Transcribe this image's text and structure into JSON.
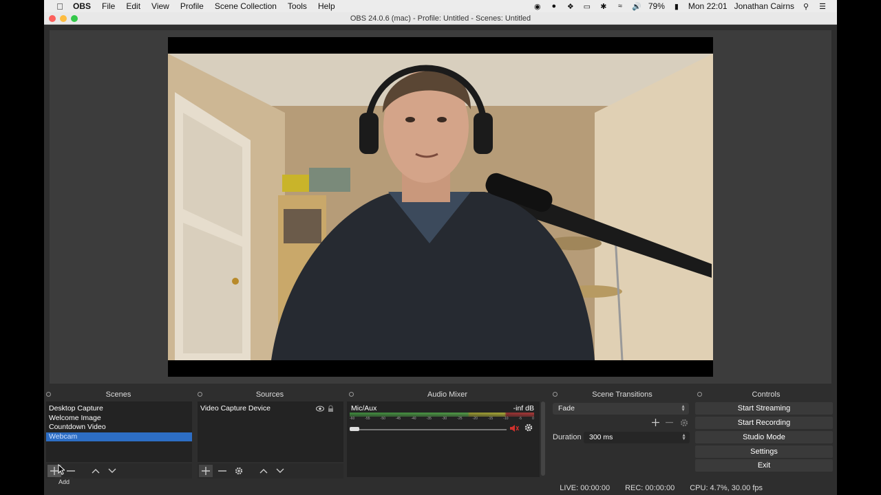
{
  "menubar": {
    "apple_icon": "apple-icon",
    "items": [
      "OBS",
      "File",
      "Edit",
      "View",
      "Profile",
      "Scene Collection",
      "Tools",
      "Help"
    ],
    "battery": "79%",
    "clock": "Mon 22:01",
    "user": "Jonathan Cairns"
  },
  "window": {
    "title": "OBS 24.0.6 (mac) - Profile: Untitled - Scenes: Untitled"
  },
  "scenes": {
    "title": "Scenes",
    "items": [
      "Desktop Capture",
      "Welcome Image",
      "Countdown Video",
      "Webcam"
    ],
    "selected_index": 3
  },
  "sources": {
    "title": "Sources",
    "items": [
      "Video Capture Device"
    ]
  },
  "mixer": {
    "title": "Audio Mixer",
    "channel": "Mic/Aux",
    "level": "-inf dB",
    "ticks": [
      "-60",
      "-55",
      "-50",
      "-45",
      "-40",
      "-35",
      "-30",
      "-25",
      "-20",
      "-15",
      "-10",
      "-5",
      "0"
    ],
    "volume_fraction": 0.0,
    "muted": true
  },
  "transitions": {
    "title": "Scene Transitions",
    "selected": "Fade",
    "duration_label": "Duration",
    "duration_value": "300 ms"
  },
  "controls": {
    "title": "Controls",
    "buttons": [
      "Start Streaming",
      "Start Recording",
      "Studio Mode",
      "Settings",
      "Exit"
    ]
  },
  "status": {
    "live": "LIVE: 00:00:00",
    "rec": "REC: 00:00:00",
    "cpu": "CPU: 4.7%, 30.00 fps"
  },
  "tooltip": "Add",
  "colors": {
    "selection": "#2d6ec5",
    "muted_icon": "#d0312d"
  }
}
